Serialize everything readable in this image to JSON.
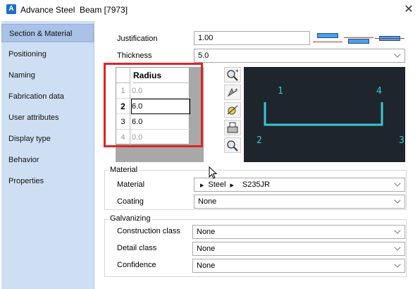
{
  "window": {
    "app_title": "Advance Steel",
    "object_title": "Beam [7973]",
    "close_glyph": "✕"
  },
  "sidebar": {
    "items": [
      {
        "label": "Section & Material",
        "active": true
      },
      {
        "label": "Positioning"
      },
      {
        "label": "Naming"
      },
      {
        "label": "Fabrication data"
      },
      {
        "label": "User attributes"
      },
      {
        "label": "Display type"
      },
      {
        "label": "Behavior"
      },
      {
        "label": "Properties"
      }
    ]
  },
  "section": {
    "justification_label": "Justification",
    "justification_value": "1.00",
    "thickness_label": "Thickness",
    "thickness_value": "5.0"
  },
  "radius_grid": {
    "header": "Radius",
    "rows": [
      {
        "num": "1",
        "value": "0.0"
      },
      {
        "num": "2",
        "value": "6.0"
      },
      {
        "num": "3",
        "value": "6.0"
      },
      {
        "num": "4",
        "value": "0.0"
      }
    ]
  },
  "preview": {
    "labels": [
      "1",
      "4",
      "2",
      "3"
    ]
  },
  "material": {
    "group_title": "Material",
    "material_label": "Material",
    "material_path": [
      "Steel",
      "S235JR"
    ],
    "coating_label": "Coating",
    "coating_value": "None"
  },
  "galvanizing": {
    "group_title": "Galvanizing",
    "construction_label": "Construction class",
    "construction_value": "None",
    "detail_label": "Detail class",
    "detail_value": "None",
    "confidence_label": "Confidence",
    "confidence_value": "None"
  },
  "colors": {
    "sidebar_bg": "#cfdff3",
    "active_item": "#a9c2e6",
    "preview_bg": "#1f252d",
    "preview_line": "#39c6d1",
    "highlight": "#e02424"
  }
}
